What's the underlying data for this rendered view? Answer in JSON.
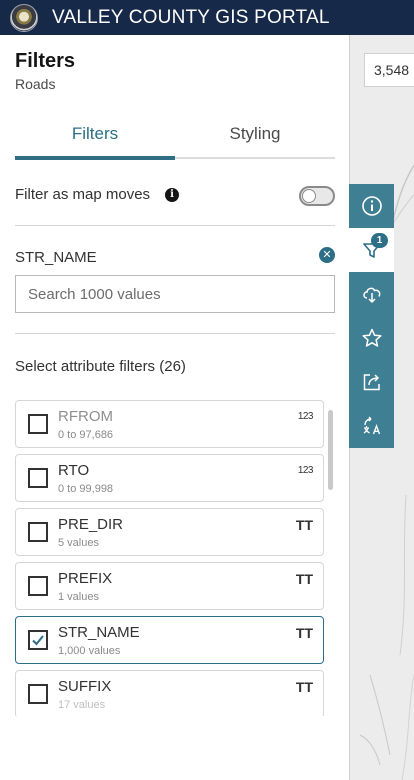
{
  "header": {
    "title": "VALLEY COUNTY GIS PORTAL",
    "brand_color": "#172949"
  },
  "map": {
    "feature_count": "3,548"
  },
  "panel": {
    "title": "Filters",
    "subtitle": "Roads",
    "tabs": [
      {
        "label": "Filters",
        "active": true
      },
      {
        "label": "Styling",
        "active": false
      }
    ],
    "filter_as_map_moves": {
      "label": "Filter as map moves",
      "enabled": false,
      "info_icon": "info-icon"
    },
    "active_field": {
      "label": "STR_NAME",
      "search_placeholder": "Search 1000 values",
      "search_value": ""
    },
    "attribute_section_label": "Select attribute filters (26)",
    "attributes": [
      {
        "name": "RFROM",
        "detail": "0 to 97,686",
        "type_icon": "123",
        "checked": false
      },
      {
        "name": "RTO",
        "detail": "0 to 99,998",
        "type_icon": "123",
        "checked": false
      },
      {
        "name": "PRE_DIR",
        "detail": "5 values",
        "type_icon": "TT",
        "checked": false
      },
      {
        "name": "PREFIX",
        "detail": "1 values",
        "type_icon": "TT",
        "checked": false
      },
      {
        "name": "STR_NAME",
        "detail": "1,000 values",
        "type_icon": "TT",
        "checked": true
      },
      {
        "name": "SUFFIX",
        "detail": "17 values",
        "type_icon": "TT",
        "checked": false
      }
    ]
  },
  "toolbar": {
    "accent_color": "#3f7f93",
    "filter_badge": "1",
    "buttons": [
      "info-icon",
      "filter-icon",
      "download-icon",
      "star-icon",
      "share-icon",
      "translate-icon"
    ]
  }
}
